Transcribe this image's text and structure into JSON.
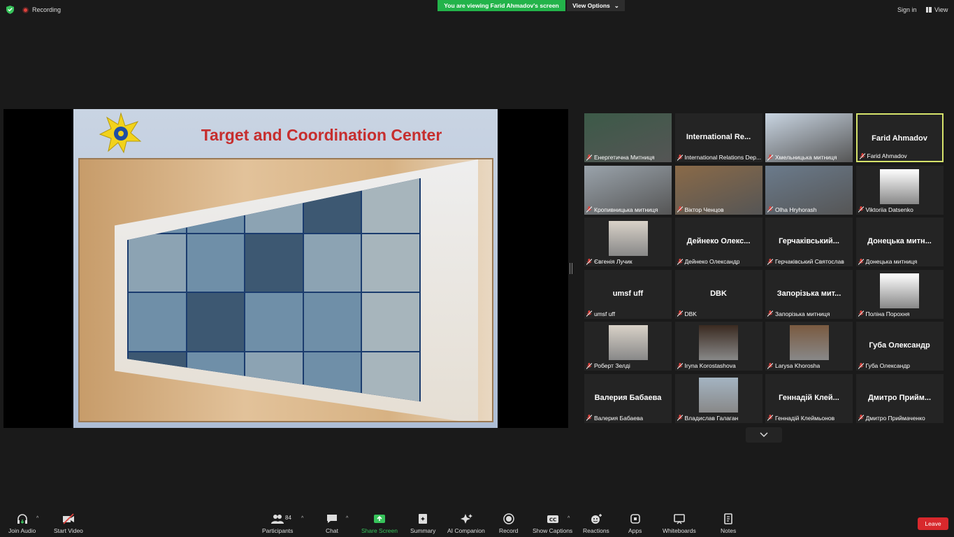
{
  "topbar": {
    "recording_label": "Recording",
    "viewing_banner": "You are viewing Farid Ahmadov's screen",
    "view_options": "View Options",
    "sign_in": "Sign in",
    "view": "View"
  },
  "slide": {
    "title": "Target and Coordination Center"
  },
  "participants": [
    {
      "display": "",
      "name": "Енергетична Митниця",
      "video": true,
      "active": false
    },
    {
      "display": "International Re...",
      "name": "International Relations Dep...",
      "video": false,
      "active": false
    },
    {
      "display": "",
      "name": "Хмельницька митниця",
      "video": true,
      "active": false
    },
    {
      "display": "Farid Ahmadov",
      "name": "Farid Ahmadov",
      "video": false,
      "active": true
    },
    {
      "display": "",
      "name": "Кропивницька митниця",
      "video": true,
      "active": false
    },
    {
      "display": "",
      "name": "Віктор Ченцов",
      "video": true,
      "active": false
    },
    {
      "display": "",
      "name": "Olha Hryhorash",
      "video": true,
      "active": false
    },
    {
      "display": "",
      "name": "Viktoriia Datsenko",
      "video": false,
      "avatar": true,
      "active": false
    },
    {
      "display": "",
      "name": "Євгенія Лучик",
      "video": false,
      "avatar": true,
      "active": false
    },
    {
      "display": "Дейнеко Олекс...",
      "name": "Дейнеко Олександр",
      "video": false,
      "active": false
    },
    {
      "display": "Герчаківський...",
      "name": "Герчаківський Святослав",
      "video": false,
      "active": false
    },
    {
      "display": "Донецька митн...",
      "name": "Донецька митниця",
      "video": false,
      "active": false
    },
    {
      "display": "umsf uff",
      "name": "umsf uff",
      "video": false,
      "active": false
    },
    {
      "display": "DBK",
      "name": "DBK",
      "video": false,
      "active": false
    },
    {
      "display": "Запорізька мит...",
      "name": "Запорізька митниця",
      "video": false,
      "active": false
    },
    {
      "display": "",
      "name": "Поліна Порохня",
      "video": false,
      "avatar": true,
      "active": false
    },
    {
      "display": "",
      "name": "Роберт Зелді",
      "video": false,
      "avatar": true,
      "active": false
    },
    {
      "display": "",
      "name": "Iryna Korostashova",
      "video": false,
      "avatar": true,
      "active": false
    },
    {
      "display": "",
      "name": "Larysa Khorosha",
      "video": false,
      "avatar": true,
      "active": false
    },
    {
      "display": "Губа Олександр",
      "name": "Губа Олександр",
      "video": false,
      "active": false
    },
    {
      "display": "Валерия Бабаева",
      "name": "Валерия Бабаева",
      "video": false,
      "active": false
    },
    {
      "display": "",
      "name": "Владислав Галаган",
      "video": false,
      "avatar": true,
      "active": false
    },
    {
      "display": "Геннадій Клей...",
      "name": "Геннадій Клеймьонов",
      "video": false,
      "active": false
    },
    {
      "display": "Дмитро Прийм...",
      "name": "Дмитро Приймаченко",
      "video": false,
      "active": false
    }
  ],
  "toolbar": {
    "join_audio": "Join Audio",
    "start_video": "Start Video",
    "participants": "Participants",
    "participants_count": "84",
    "chat": "Chat",
    "share_screen": "Share Screen",
    "summary": "Summary",
    "ai_companion": "AI Companion",
    "record": "Record",
    "show_captions": "Show Captions",
    "reactions": "Reactions",
    "apps": "Apps",
    "whiteboards": "Whiteboards",
    "notes": "Notes",
    "leave": "Leave"
  },
  "colors": {
    "banner_green": "#23b34a",
    "active_border": "#d6e36b",
    "leave_red": "#d8282c",
    "share_green": "#37c35a"
  }
}
